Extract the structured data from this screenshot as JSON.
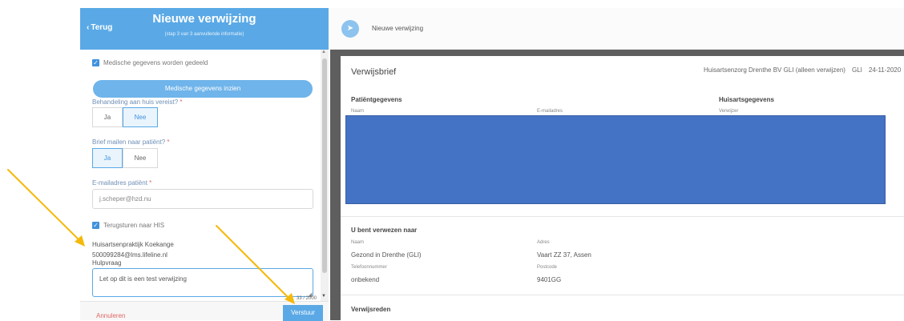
{
  "left_panel": {
    "back_label": "Terug",
    "title": "Nieuwe verwijzing",
    "subtitle": "(stap 3 van 3 aanvullende informatie)",
    "medical_shared_label": "Medische gegevens worden gedeeld",
    "medical_view_button": "Medische gegevens inzien",
    "home_treatment": {
      "label": "Behandeling aan huis vereist?",
      "required_mark": "*",
      "options": [
        "Ja",
        "Nee"
      ],
      "selected": "Nee"
    },
    "mail_letter": {
      "label": "Brief mailen naar patiënt?",
      "required_mark": "*",
      "options": [
        "Ja",
        "Nee"
      ],
      "selected": "Ja"
    },
    "email_field": {
      "label": "E-mailadres patiënt",
      "required_mark": "*",
      "value": "j.scheper@hzd.nu"
    },
    "return_his_label": "Terugsturen naar HIS",
    "practice_name": "Huisartsenpraktijk Koekange",
    "practice_email": "500099284@lms.lifeline.nl",
    "hulpvraag": {
      "label": "Hulpvraag",
      "value": "Let op dit is een test verwijzing",
      "counter": "33 / 2000"
    },
    "cancel_label": "Annuleren",
    "send_label": "Verstuur"
  },
  "right_panel": {
    "header_title": "Nieuwe verwijzing",
    "doc_title": "Verwijsbrief",
    "doc_org": "Huisartsenzorg Drenthe BV GLI (alleen verwijzen)",
    "doc_code": "GLI",
    "doc_date": "24-11-2020",
    "patient_heading": "Patiëntgegevens",
    "patient_name_label": "Naam",
    "patient_email_label": "E-mailadres",
    "gp_heading": "Huisartsgegevens",
    "gp_referrer_label": "Verwijzer",
    "referred_heading": "U bent verwezen naar",
    "referred_name_label": "Naam",
    "referred_name": "Gezond in Drenthe (GLI)",
    "address_label": "Adres",
    "address": "Vaart ZZ 37, Assen",
    "phone_label": "Telefoonnummer",
    "phone": "onbekend",
    "postcode_label": "Postcode",
    "postcode": "9401GG",
    "reason_heading": "Verwijsreden"
  },
  "colors": {
    "primary": "#5aa9e6",
    "redaction": "#4472c4",
    "annotation_arrow": "#f5b90a",
    "danger": "#e06666"
  }
}
